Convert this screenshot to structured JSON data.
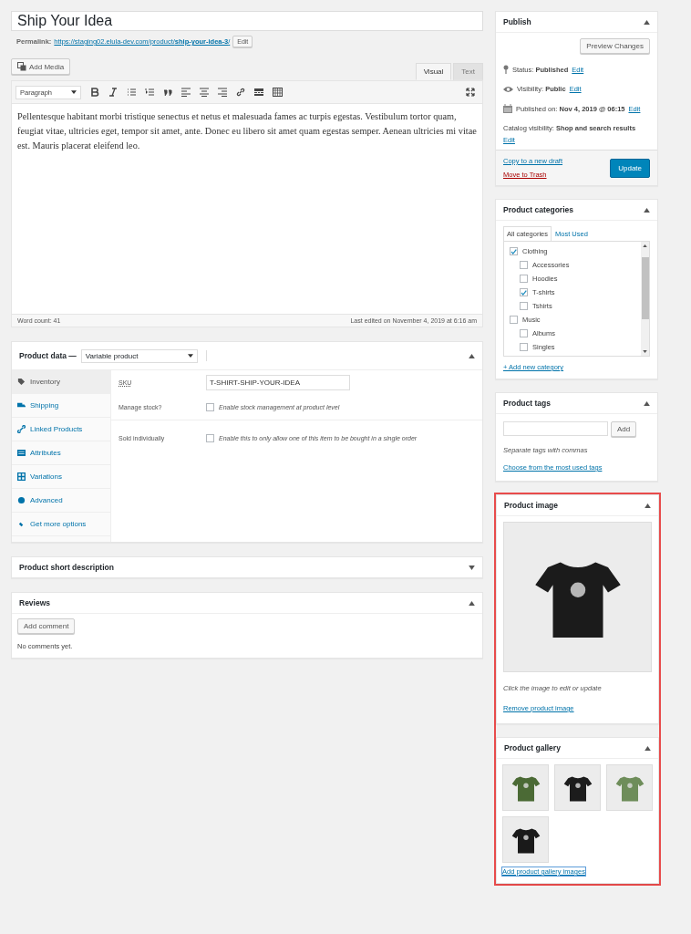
{
  "post_title": "Ship Your Idea",
  "permalink": {
    "label": "Permalink:",
    "url": "https://staging02.elula-dev.com/product/**ship-your-idea-3**/",
    "edit_button": "Edit"
  },
  "editor": {
    "add_media": "Add Media",
    "tabs": [
      {
        "label": "Visual",
        "selected": true
      },
      {
        "label": "Text",
        "selected": false
      }
    ],
    "format_select": "Paragraph",
    "content": "Pellentesque habitant morbi tristique senectus et netus et malesuada fames ac turpis egestas. Vestibulum tortor quam, feugiat vitae, ultricies eget, tempor sit amet, ante. Donec eu libero sit amet quam egestas semper. Aenean ultricies mi vitae est. Mauris placerat eleifend leo.",
    "word_count": "Word count: 41",
    "last_edited": "Last edited on November 4, 2019 at 6:16 am"
  },
  "product_data": {
    "title": "Product data —",
    "type_select": "Variable product",
    "expanded": true,
    "tabs": [
      {
        "label": "Inventory",
        "selected": true
      },
      {
        "label": "Shipping",
        "selected": false
      },
      {
        "label": "Linked Products",
        "selected": false
      },
      {
        "label": "Attributes",
        "selected": false
      },
      {
        "label": "Variations",
        "selected": false
      },
      {
        "label": "Advanced",
        "selected": false
      },
      {
        "label": "Get more options",
        "selected": false
      }
    ],
    "fields": [
      {
        "kind": "text",
        "label": "SKU",
        "value": "T-SHIRT-SHIP-YOUR-IDEA"
      },
      {
        "kind": "checkbox",
        "label": "Manage stock?",
        "description": "Enable stock management at product level",
        "checked": false
      },
      {
        "kind": "checkbox",
        "label": "Sold individually",
        "description": "Enable this to only allow one of this item to be bought in a single order",
        "checked": false
      }
    ]
  },
  "short_description": {
    "title": "Product short description",
    "expanded": false
  },
  "reviews": {
    "title": "Reviews",
    "expanded": true,
    "add_comment": "Add comment",
    "empty_text": "No comments yet."
  },
  "publish": {
    "title": "Publish",
    "expanded": true,
    "preview_button": "Preview Changes",
    "meta": [
      {
        "kind": "status",
        "text": "Status: **Published**",
        "edit": "Edit"
      },
      {
        "kind": "visibility",
        "text": "Visibility: **Public**",
        "edit": "Edit"
      },
      {
        "kind": "date",
        "text": "Published on: **Nov 4, 2019 @ 06:15**",
        "edit": "Edit"
      },
      {
        "kind": "catalog",
        "text": "Catalog visibility: **Shop and search results**",
        "edit": "Edit"
      }
    ],
    "copy_link": "Copy to a new draft",
    "trash_link": "Move to Trash",
    "update_button": "Update"
  },
  "categories": {
    "title": "Product categories",
    "expanded": true,
    "tabs": [
      {
        "label": "All categories",
        "selected": true
      },
      {
        "label": "Most Used",
        "selected": false
      }
    ],
    "items": [
      {
        "label": "Clothing",
        "checked": true,
        "children": [
          {
            "label": "Accessories",
            "checked": false
          },
          {
            "label": "Hoodies",
            "checked": false
          },
          {
            "label": "T-shirts",
            "checked": true
          },
          {
            "label": "Tshirts",
            "checked": false
          }
        ]
      },
      {
        "label": "Music",
        "checked": false,
        "children": [
          {
            "label": "Albums",
            "checked": false
          },
          {
            "label": "Singles",
            "checked": false
          }
        ]
      }
    ],
    "add_link": "+ Add new category"
  },
  "tags": {
    "title": "Product tags",
    "expanded": true,
    "add_button": "Add",
    "hint": "Separate tags with commas",
    "choose_link": "Choose from the most used tags"
  },
  "product_image": {
    "title": "Product image",
    "expanded": true,
    "hint": "Click the image to edit or update",
    "remove_link": "Remove product image"
  },
  "gallery": {
    "title": "Product gallery",
    "expanded": true,
    "images": [
      {
        "color": "#4b6a35"
      },
      {
        "color": "#1c1c1c"
      },
      {
        "color": "#6e8d5a"
      },
      {
        "color": "#1a1a1a"
      }
    ],
    "add_link": "Add product gallery images"
  }
}
